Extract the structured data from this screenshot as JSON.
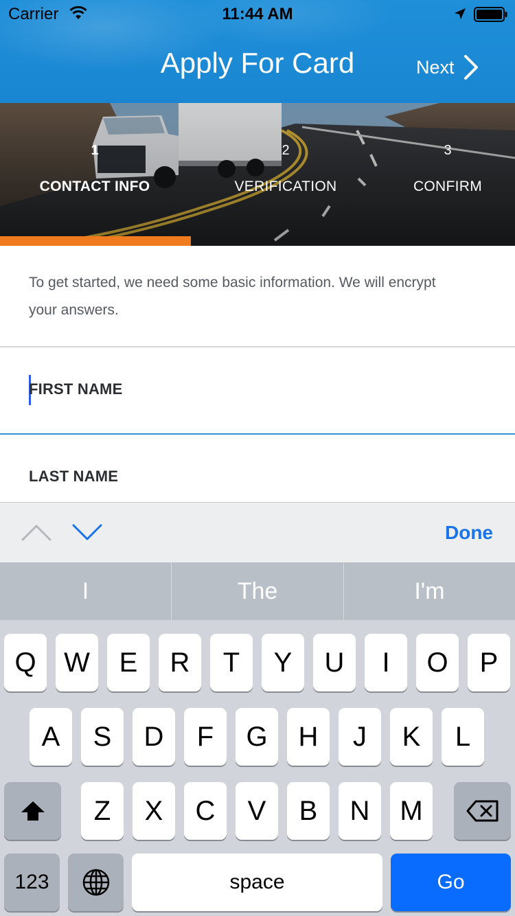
{
  "status_bar": {
    "carrier": "Carrier",
    "time": "11:44 AM",
    "icons": [
      "wifi-icon",
      "location-arrow-icon",
      "battery-icon"
    ]
  },
  "header": {
    "title": "Apply For Card",
    "next_label": "Next",
    "background_color": "#1f8fd9"
  },
  "steps": [
    {
      "number": "1",
      "label": "CONTACT INFO",
      "active": true
    },
    {
      "number": "2",
      "label": "VERIFICATION",
      "active": false
    },
    {
      "number": "3",
      "label": "CONFIRM",
      "active": false
    }
  ],
  "progress": {
    "fraction": 0.37,
    "color": "#f07a1e"
  },
  "form": {
    "intro": "To get started, we need some basic information. We will encrypt your answers.",
    "fields": [
      {
        "label": "FIRST NAME",
        "value": "",
        "focused": true
      },
      {
        "label": "LAST NAME",
        "value": "",
        "focused": false
      }
    ],
    "focus_color": "#3a8fd6"
  },
  "keyboard_accessory": {
    "done_label": "Done",
    "icons": [
      "chevron-up-icon",
      "chevron-down-icon"
    ]
  },
  "keyboard": {
    "suggestions": [
      "I",
      "The",
      "I'm"
    ],
    "row1": [
      "Q",
      "W",
      "E",
      "R",
      "T",
      "Y",
      "U",
      "I",
      "O",
      "P"
    ],
    "row2": [
      "A",
      "S",
      "D",
      "F",
      "G",
      "H",
      "J",
      "K",
      "L"
    ],
    "row3": [
      "Z",
      "X",
      "C",
      "V",
      "B",
      "N",
      "M"
    ],
    "numbers_label": "123",
    "space_label": "space",
    "go_label": "Go",
    "accent_color": "#0a6cff"
  }
}
